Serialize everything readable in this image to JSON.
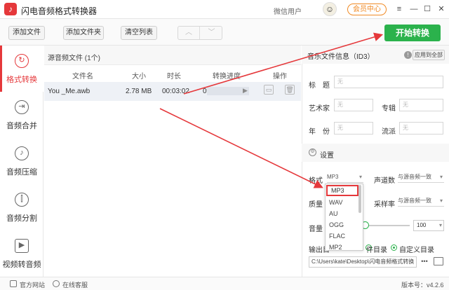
{
  "app": {
    "logo_glyph": "♪",
    "title": "闪电音频格式转换器",
    "user_label": "微信用户",
    "avatar_glyph": "☺",
    "vip_label": "会员中心",
    "win_menu": "≡",
    "win_min": "—",
    "win_max": "☐",
    "win_close": "✕"
  },
  "toolbar": {
    "add_file": "添加文件",
    "add_folder": "添加文件夹",
    "clear_list": "清空列表",
    "nav_up": "︿",
    "nav_down": "﹀",
    "start": "开始转换"
  },
  "sidebar": {
    "items": [
      {
        "label": "格式转换",
        "icon_glyph": "↻",
        "icon": "convert-icon"
      },
      {
        "label": "音频合并",
        "icon_glyph": "⇥",
        "icon": "merge-icon"
      },
      {
        "label": "音频压缩",
        "icon_glyph": "♪",
        "icon": "compress-icon"
      },
      {
        "label": "音频分割",
        "icon_glyph": "⫿",
        "icon": "split-icon"
      },
      {
        "label": "视频转音频",
        "icon_glyph": "▶",
        "icon": "video-icon"
      }
    ]
  },
  "filelist": {
    "title": "源音频文件 (1个)",
    "columns": [
      "文件名",
      "大小",
      "时长",
      "转换进度",
      "操作"
    ],
    "rows": [
      {
        "name": "You _Me.awb",
        "size": "2.78 MB",
        "duration": "00:03:02",
        "progress": "0%",
        "progress_value": 0
      }
    ]
  },
  "id3": {
    "title": "音乐文件信息（ID3）",
    "info_glyph": "!",
    "apply_all": "应用到全部",
    "title_label": "标　题",
    "artist_label": "艺术家",
    "album_label": "专辑",
    "year_label": "年　份",
    "genre_label": "流派",
    "placeholder": "无"
  },
  "settings": {
    "title": "设置",
    "gear_glyph": "⚙",
    "format_label": "格式",
    "format_value": "MP3",
    "channels_label": "声道数",
    "channels_value": "与源音频一致",
    "quality_label": "质量",
    "samplerate_label": "采样率",
    "samplerate_value": "与源音频一致",
    "volume_label": "音量",
    "volume_value": "100",
    "output_label": "输出目",
    "src_dir_label": "件目录",
    "custom_dir_label": "自定义目录",
    "path": "C:\\Users\\kate\\Desktop\\闪电音频格式转换",
    "dots": "•••",
    "arrow_glyph": "▾",
    "format_options": [
      "MP3",
      "WAV",
      "AU",
      "OGG",
      "FLAC",
      "MP2"
    ]
  },
  "status": {
    "website": "官方网站",
    "support": "在线客服",
    "version": "版本号：v4.2.6"
  },
  "colors": {
    "accent_red": "#e5383b",
    "start_green": "#2bb24c",
    "vip_orange": "#f08a24"
  }
}
